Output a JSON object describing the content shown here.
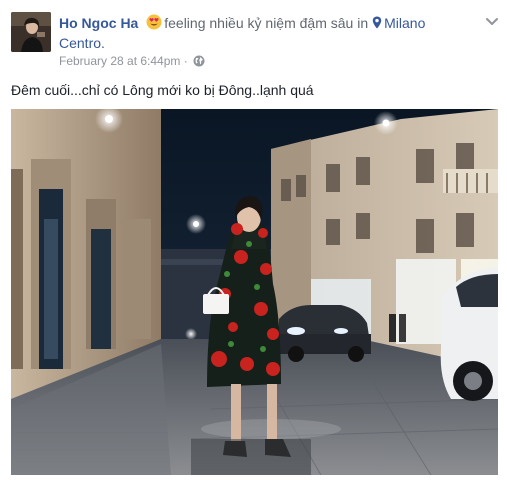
{
  "post": {
    "author": "Ho Ngoc Ha",
    "feeling": "feeling nhiều kỷ niệm đậm sâu",
    "in_word": "in",
    "place_line1": "Milano",
    "place_line2": "Centro.",
    "timestamp": "February 28 at 6:44pm",
    "separator": "·",
    "caption": "Đêm cuối...chỉ có Lông mới ko bị Đông..lạnh quá"
  },
  "icons": {
    "feeling": "smiling-face-with-heart-eyes-icon",
    "place": "map-pin-icon",
    "audience": "globe-icon",
    "menu": "chevron-down-icon"
  },
  "colors": {
    "link": "#365899",
    "text": "#1d2129",
    "muted": "#90949c",
    "secondary": "#616770"
  }
}
